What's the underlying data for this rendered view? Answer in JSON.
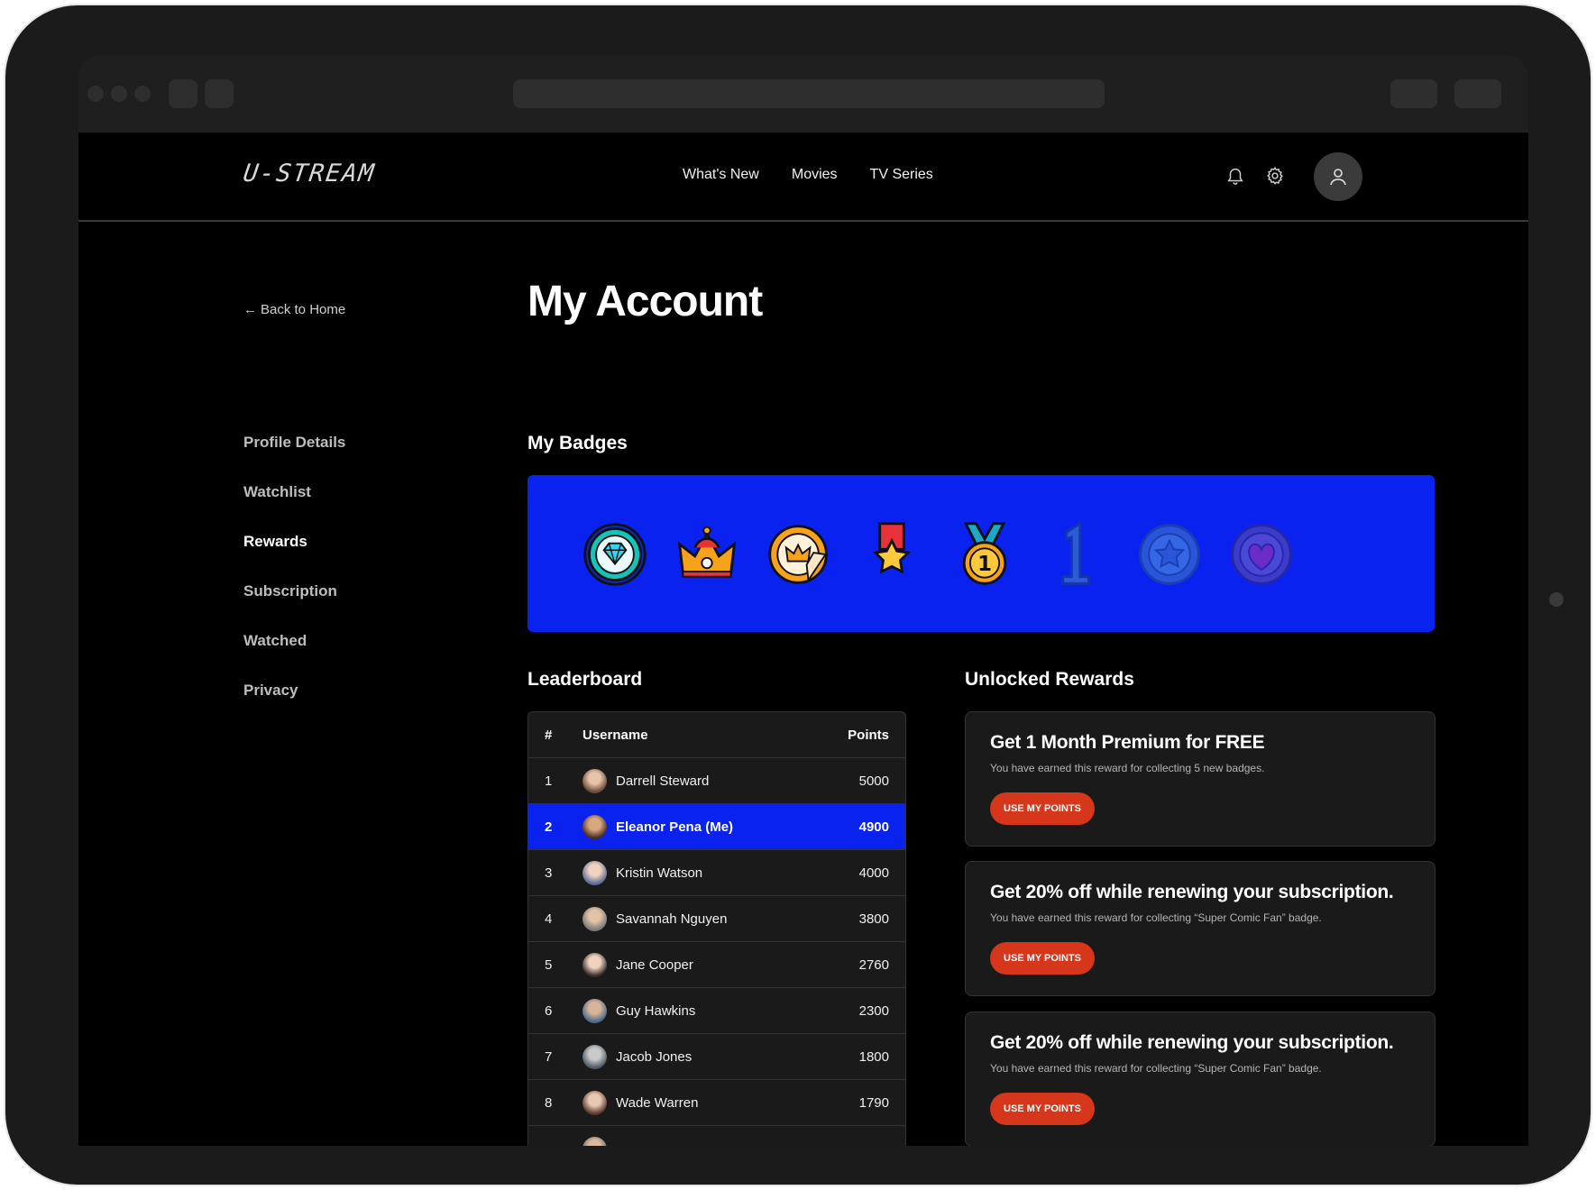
{
  "header": {
    "logo": "U-STREAM",
    "nav": [
      "What's New",
      "Movies",
      "TV Series"
    ]
  },
  "sidebar": {
    "back_label": "Back to Home",
    "items": [
      "Profile Details",
      "Watchlist",
      "Rewards",
      "Subscription",
      "Watched",
      "Privacy"
    ],
    "active": "Rewards"
  },
  "main": {
    "title": "My Account",
    "badges_title": "My Badges",
    "badges": [
      "diamond-badge",
      "crown-badge",
      "crown-sticker-badge",
      "star-ribbon-badge",
      "number-one-medal-badge",
      "number-one-badge",
      "star-coin-badge",
      "heart-coin-badge"
    ],
    "leaderboard_title": "Leaderboard",
    "rewards_title": "Unlocked Rewards"
  },
  "leaderboard": {
    "columns": [
      "#",
      "Username",
      "Points"
    ],
    "rows": [
      {
        "rank": "1",
        "name": "Darrell Steward",
        "points": "5000"
      },
      {
        "rank": "2",
        "name": "Eleanor Pena (Me)",
        "points": "4900"
      },
      {
        "rank": "3",
        "name": "Kristin Watson",
        "points": "4000"
      },
      {
        "rank": "4",
        "name": "Savannah Nguyen",
        "points": "3800"
      },
      {
        "rank": "5",
        "name": "Jane Cooper",
        "points": "2760"
      },
      {
        "rank": "6",
        "name": "Guy Hawkins",
        "points": "2300"
      },
      {
        "rank": "7",
        "name": "Jacob Jones",
        "points": "1800"
      },
      {
        "rank": "8",
        "name": "Wade Warren",
        "points": "1790"
      }
    ]
  },
  "rewards": [
    {
      "title": "Get 1 Month Premium for FREE",
      "desc": "You have earned this reward for collecting 5 new badges.",
      "button": "USE MY POINTS"
    },
    {
      "title": "Get 20% off while renewing your subscription.",
      "desc": "You have earned this reward for collecting “Super Comic Fan” badge.",
      "button": "USE MY POINTS"
    },
    {
      "title": "Get 20% off while renewing your subscription.",
      "desc": "You have earned this reward for collecting “Super Comic Fan” badge.",
      "button": "USE MY POINTS"
    }
  ],
  "colors": {
    "accent_blue": "#0a22f0",
    "button_red": "#d6361a",
    "background": "#000000"
  }
}
